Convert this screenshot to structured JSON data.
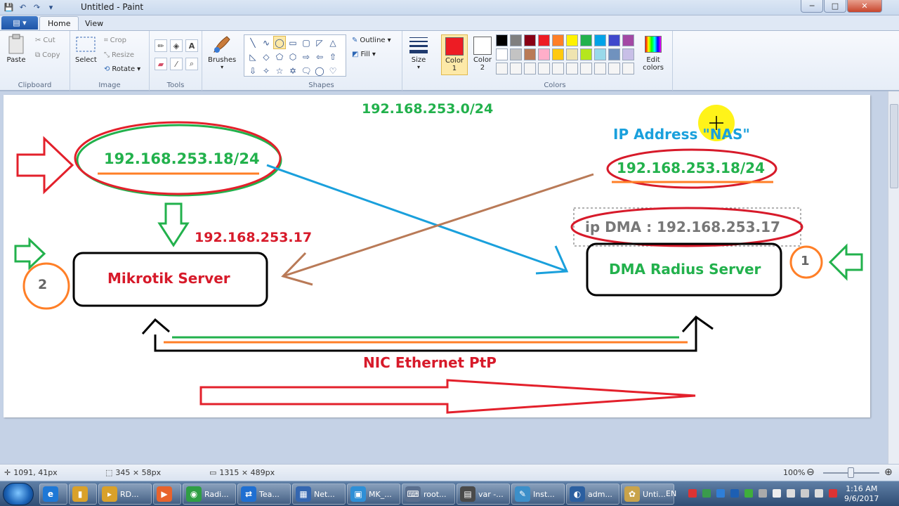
{
  "window": {
    "title": "Untitled - Paint",
    "minimize_glyph": "─",
    "maximize_glyph": "□",
    "close_glyph": "✕"
  },
  "quick_access": {
    "menu_glyph": "▤",
    "save_glyph": "💾",
    "undo_glyph": "↶",
    "redo_glyph": "↷",
    "dropdown_glyph": "▾"
  },
  "tabs": {
    "file_glyph": "▤ ▾",
    "home": "Home",
    "view": "View"
  },
  "ribbon": {
    "clipboard": {
      "label": "Clipboard",
      "paste": "Paste",
      "cut": "Cut",
      "copy": "Copy"
    },
    "image": {
      "label": "Image",
      "select": "Select",
      "crop": "Crop",
      "resize": "Resize",
      "rotate": "Rotate"
    },
    "tools": {
      "label": "Tools"
    },
    "brushes": {
      "label": "Brushes"
    },
    "shapes": {
      "label": "Shapes",
      "outline": "Outline",
      "fill": "Fill",
      "items": [
        "╲",
        "∿",
        "◯",
        "▭",
        "▢",
        "◸",
        "△",
        "◺",
        "◇",
        "⬠",
        "⬡",
        "⇨",
        "⇦",
        "⇧",
        "⇩",
        "✧",
        "☆",
        "✡",
        "🗨",
        "◯",
        "♡"
      ]
    },
    "size": {
      "label": "Size"
    },
    "colors": {
      "label": "Colors",
      "color1_label": "Color\n1",
      "color2_label": "Color\n2",
      "color1": "#ed1c24",
      "color2": "#ffffff",
      "edit_colors": "Edit\ncolors",
      "palette": [
        "#000000",
        "#7f7f7f",
        "#880015",
        "#ed1c24",
        "#ff7f27",
        "#fff200",
        "#22b14c",
        "#00a2e8",
        "#3f48cc",
        "#a349a4",
        "#ffffff",
        "#c3c3c3",
        "#b97a57",
        "#ffaec9",
        "#ffc90e",
        "#efe4b0",
        "#b5e61d",
        "#99d9ea",
        "#7092be",
        "#c8bfe7",
        "#f5f5f5",
        "#f5f5f5",
        "#f5f5f5",
        "#f5f5f5",
        "#f5f5f5",
        "#f5f5f5",
        "#f5f5f5",
        "#f5f5f5",
        "#f5f5f5",
        "#f5f5f5"
      ]
    }
  },
  "canvas": {
    "subnet": "192.168.253.0/24",
    "mikrotik_ip": "192.168.253.18/24",
    "gateway_ip": "192.168.253.17",
    "mikrotik_server": "Mikrotik Server",
    "nas_title": "IP Address \"NAS\"",
    "nas_ip": "192.168.253.18/24",
    "dma_ip": "ip DMA : 192.168.253.17",
    "dma_server": "DMA Radius Server",
    "link_label": "NIC Ethernet PtP",
    "badge_left": "2",
    "badge_right": "1"
  },
  "statusbar": {
    "cursor_pos": "1091, 41px",
    "selection_size": "345 × 58px",
    "image_size": "1315 × 489px",
    "zoom": "100%",
    "zoom_out": "⊖",
    "zoom_in": "⊕"
  },
  "taskbar": {
    "items": [
      {
        "label": "",
        "icon": "e",
        "color": "#1e78d6"
      },
      {
        "label": "",
        "icon": "▮",
        "color": "#d9a12a"
      },
      {
        "label": "RD...",
        "icon": "▸",
        "color": "#d9a12a"
      },
      {
        "label": "",
        "icon": "▶",
        "color": "#e8632c"
      },
      {
        "label": "Radi...",
        "icon": "◉",
        "color": "#2f9e44"
      },
      {
        "label": "Tea...",
        "icon": "⇄",
        "color": "#1f6fd1"
      },
      {
        "label": "Net...",
        "icon": "▦",
        "color": "#3466b0"
      },
      {
        "label": "MK_...",
        "icon": "▣",
        "color": "#2e8fd6"
      },
      {
        "label": "root...",
        "icon": "⌨",
        "color": "#5a6f8e"
      },
      {
        "label": "var -...",
        "icon": "▤",
        "color": "#4a4a4a"
      },
      {
        "label": "Inst...",
        "icon": "✎",
        "color": "#3c8fc9"
      },
      {
        "label": "adm...",
        "icon": "◐",
        "color": "#2b5fa0"
      },
      {
        "label": "Unti...",
        "icon": "✿",
        "color": "#c9a34a"
      }
    ],
    "language": "EN",
    "time": "1:16 AM",
    "date": "9/6/2017"
  }
}
